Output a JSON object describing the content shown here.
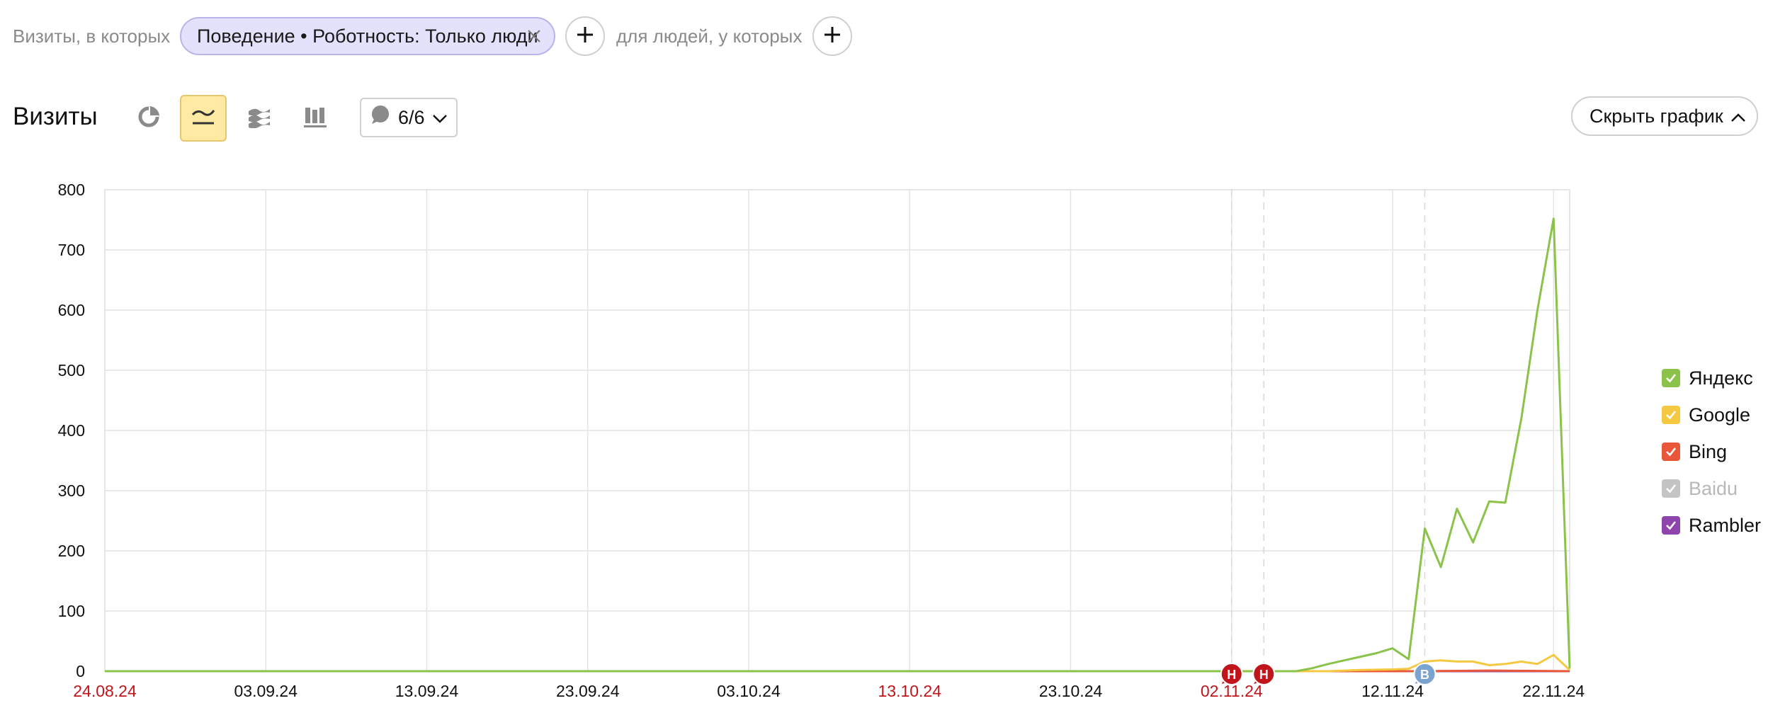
{
  "filters": {
    "visits_label": "Визиты, в которых",
    "chip_text": "Поведение • Роботность: Только люди",
    "people_label": "для людей, у которых"
  },
  "toolbar": {
    "title": "Визиты",
    "annotations_count": "6/6",
    "hide_chart_label": "Скрыть график",
    "active_chart_mode": "line",
    "icons": [
      "pie-chart-icon",
      "line-chart-icon",
      "stacked-area-icon",
      "stacked-bar-icon",
      "comment-icon",
      "chevron-down-icon",
      "chevron-up-icon"
    ]
  },
  "chart_data": {
    "type": "line",
    "ylim": [
      0,
      800
    ],
    "y_ticks": [
      "0",
      "100",
      "200",
      "300",
      "400",
      "500",
      "600",
      "700",
      "800"
    ],
    "x_tick_labels": [
      {
        "label": "24.08.24",
        "holiday": true
      },
      {
        "label": "03.09.24",
        "holiday": false
      },
      {
        "label": "13.09.24",
        "holiday": false
      },
      {
        "label": "23.09.24",
        "holiday": false
      },
      {
        "label": "03.10.24",
        "holiday": false
      },
      {
        "label": "13.10.24",
        "holiday": true
      },
      {
        "label": "23.10.24",
        "holiday": false
      },
      {
        "label": "02.11.24",
        "holiday": true
      },
      {
        "label": "12.11.24",
        "holiday": false
      },
      {
        "label": "22.11.24",
        "holiday": false
      }
    ],
    "date_start": "24.08.24",
    "date_end": "23.11.24",
    "grid": true,
    "annotation_markers": [
      {
        "date": "02.11.24",
        "letter": "Н",
        "color": "#c0151b"
      },
      {
        "date": "04.11.24",
        "letter": "Н",
        "color": "#c0151b"
      },
      {
        "date": "14.11.24",
        "letter": "В",
        "color": "#7ba3cf"
      }
    ],
    "series": [
      {
        "name": "Яндекс",
        "color": "#8bc34a",
        "enabled": true,
        "points": [
          {
            "x": "24.08.24",
            "y": 0
          },
          {
            "x": "06.11.24",
            "y": 0
          },
          {
            "x": "07.11.24",
            "y": 5
          },
          {
            "x": "08.11.24",
            "y": 12
          },
          {
            "x": "09.11.24",
            "y": 18
          },
          {
            "x": "10.11.24",
            "y": 24
          },
          {
            "x": "11.11.24",
            "y": 30
          },
          {
            "x": "12.11.24",
            "y": 38
          },
          {
            "x": "13.11.24",
            "y": 20
          },
          {
            "x": "14.11.24",
            "y": 237
          },
          {
            "x": "15.11.24",
            "y": 173
          },
          {
            "x": "16.11.24",
            "y": 270
          },
          {
            "x": "17.11.24",
            "y": 214
          },
          {
            "x": "18.11.24",
            "y": 282
          },
          {
            "x": "19.11.24",
            "y": 280
          },
          {
            "x": "20.11.24",
            "y": 420
          },
          {
            "x": "21.11.24",
            "y": 600
          },
          {
            "x": "22.11.24",
            "y": 752
          },
          {
            "x": "23.11.24",
            "y": 5
          }
        ]
      },
      {
        "name": "Google",
        "color": "#f5c842",
        "enabled": true,
        "points": [
          {
            "x": "24.08.24",
            "y": 0
          },
          {
            "x": "08.11.24",
            "y": 0
          },
          {
            "x": "10.11.24",
            "y": 2
          },
          {
            "x": "12.11.24",
            "y": 3
          },
          {
            "x": "13.11.24",
            "y": 4
          },
          {
            "x": "14.11.24",
            "y": 16
          },
          {
            "x": "15.11.24",
            "y": 18
          },
          {
            "x": "16.11.24",
            "y": 16
          },
          {
            "x": "17.11.24",
            "y": 16
          },
          {
            "x": "18.11.24",
            "y": 10
          },
          {
            "x": "19.11.24",
            "y": 12
          },
          {
            "x": "20.11.24",
            "y": 16
          },
          {
            "x": "21.11.24",
            "y": 12
          },
          {
            "x": "22.11.24",
            "y": 27
          },
          {
            "x": "23.11.24",
            "y": 2
          }
        ]
      },
      {
        "name": "Bing",
        "color": "#e8573a",
        "enabled": true,
        "points": [
          {
            "x": "24.08.24",
            "y": 0
          },
          {
            "x": "14.11.24",
            "y": 0
          },
          {
            "x": "18.11.24",
            "y": 1
          },
          {
            "x": "23.11.24",
            "y": 0
          }
        ]
      },
      {
        "name": "Baidu",
        "color": "#c4c4c4",
        "enabled": false,
        "points": []
      },
      {
        "name": "Rambler",
        "color": "#8e44ad",
        "enabled": true,
        "points": [
          {
            "x": "24.08.24",
            "y": 0
          },
          {
            "x": "23.11.24",
            "y": 0
          }
        ]
      }
    ]
  }
}
